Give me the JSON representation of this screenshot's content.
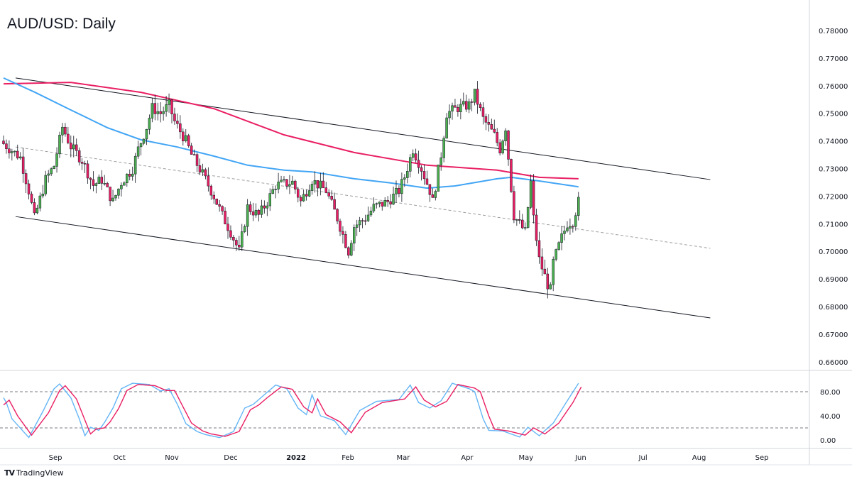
{
  "title": "AUD/USD: Daily",
  "branding": "TradingView",
  "colors": {
    "up": "#4caf50",
    "down": "#e91e63",
    "ma_fast": "#42a5f5",
    "ma_slow": "#e91e63",
    "stoch_k": "#64b5f6",
    "stoch_d": "#e91e63",
    "trend": "#131722",
    "mid": "#9e9e9e"
  },
  "chart_data": {
    "type": "candlestick",
    "title": "AUD/USD: Daily",
    "x_unit": "trading-day index",
    "price_axis": {
      "ticks": [
        "0.78000",
        "0.77000",
        "0.76000",
        "0.75000",
        "0.74000",
        "0.73000",
        "0.72000",
        "0.71000",
        "0.70000",
        "0.69000",
        "0.68000",
        "0.67000",
        "0.66000"
      ],
      "range": [
        0.658,
        0.788
      ]
    },
    "time_axis": {
      "labels": [
        {
          "label": "Sep",
          "bar": 18.5
        },
        {
          "label": "Oct",
          "bar": 41.3
        },
        {
          "label": "Nov",
          "bar": 60
        },
        {
          "label": "Dec",
          "bar": 81
        },
        {
          "label": "2022",
          "bar": 104.3,
          "bold": true
        },
        {
          "label": "Feb",
          "bar": 122.8
        },
        {
          "label": "Mar",
          "bar": 142.5
        },
        {
          "label": "Apr",
          "bar": 165.3
        },
        {
          "label": "May",
          "bar": 186.3
        },
        {
          "label": "Jun",
          "bar": 205.8
        },
        {
          "label": "Jul",
          "bar": 228
        },
        {
          "label": "Aug",
          "bar": 248
        },
        {
          "label": "Sep",
          "bar": 270.4
        }
      ],
      "total_bars": 287
    },
    "close_waypoints": [
      [
        0,
        0.739
      ],
      [
        6,
        0.734
      ],
      [
        9,
        0.722
      ],
      [
        11,
        0.712
      ],
      [
        15,
        0.726
      ],
      [
        18,
        0.731
      ],
      [
        21,
        0.745
      ],
      [
        24,
        0.738
      ],
      [
        28,
        0.733
      ],
      [
        32,
        0.724
      ],
      [
        35,
        0.726
      ],
      [
        39,
        0.718
      ],
      [
        42,
        0.725
      ],
      [
        46,
        0.73
      ],
      [
        48,
        0.737
      ],
      [
        51,
        0.745
      ],
      [
        53,
        0.752
      ],
      [
        56,
        0.75
      ],
      [
        59,
        0.753
      ],
      [
        61,
        0.747
      ],
      [
        65,
        0.74
      ],
      [
        67,
        0.735
      ],
      [
        71,
        0.728
      ],
      [
        75,
        0.72
      ],
      [
        78,
        0.713
      ],
      [
        81,
        0.707
      ],
      [
        84,
        0.7
      ],
      [
        87,
        0.716
      ],
      [
        91,
        0.713
      ],
      [
        94,
        0.718
      ],
      [
        97,
        0.724
      ],
      [
        103,
        0.725
      ],
      [
        106,
        0.718
      ],
      [
        110,
        0.726
      ],
      [
        111,
        0.725
      ],
      [
        115,
        0.722
      ],
      [
        119,
        0.712
      ],
      [
        123,
        0.7
      ],
      [
        125,
        0.709
      ],
      [
        129,
        0.712
      ],
      [
        132,
        0.716
      ],
      [
        137,
        0.718
      ],
      [
        141,
        0.722
      ],
      [
        143,
        0.727
      ],
      [
        146,
        0.737
      ],
      [
        149,
        0.73
      ],
      [
        152,
        0.722
      ],
      [
        153,
        0.718
      ],
      [
        156,
        0.735
      ],
      [
        158,
        0.75
      ],
      [
        162,
        0.752
      ],
      [
        166,
        0.753
      ],
      [
        168,
        0.757
      ],
      [
        171,
        0.748
      ],
      [
        175,
        0.742
      ],
      [
        177,
        0.737
      ],
      [
        179,
        0.745
      ],
      [
        181,
        0.723
      ],
      [
        182,
        0.713
      ],
      [
        186,
        0.707
      ],
      [
        188,
        0.725
      ],
      [
        189,
        0.712
      ],
      [
        191,
        0.697
      ],
      [
        194,
        0.688
      ],
      [
        195,
        0.686
      ],
      [
        196,
        0.696
      ],
      [
        199,
        0.705
      ],
      [
        201,
        0.71
      ],
      [
        203,
        0.711
      ],
      [
        205,
        0.718
      ]
    ],
    "sma_100": [
      [
        0,
        0.7628
      ],
      [
        11,
        0.7577
      ],
      [
        24,
        0.7512
      ],
      [
        37,
        0.7448
      ],
      [
        49,
        0.7404
      ],
      [
        62,
        0.7378
      ],
      [
        75,
        0.7345
      ],
      [
        87,
        0.7312
      ],
      [
        100,
        0.7294
      ],
      [
        110,
        0.7288
      ],
      [
        125,
        0.7263
      ],
      [
        138,
        0.7248
      ],
      [
        151,
        0.7229
      ],
      [
        161,
        0.7237
      ],
      [
        176,
        0.7263
      ],
      [
        181,
        0.7268
      ],
      [
        191,
        0.7255
      ],
      [
        205,
        0.7234
      ]
    ],
    "sma_200": [
      [
        0,
        0.7607
      ],
      [
        24,
        0.7612
      ],
      [
        49,
        0.7576
      ],
      [
        75,
        0.7517
      ],
      [
        100,
        0.7422
      ],
      [
        125,
        0.7358
      ],
      [
        151,
        0.7312
      ],
      [
        176,
        0.7294
      ],
      [
        191,
        0.7268
      ],
      [
        205,
        0.7263
      ]
    ],
    "channel": {
      "upper": [
        [
          4.3,
          0.7628
        ],
        [
          252,
          0.726
        ]
      ],
      "lower": [
        [
          4.3,
          0.7126
        ],
        [
          252,
          0.6759
        ]
      ],
      "mid": [
        [
          4.3,
          0.7378
        ],
        [
          252,
          0.7011
        ]
      ]
    },
    "stochastic": {
      "ticks": [
        "80.00",
        "40.00",
        "0.00"
      ],
      "levels": [
        80,
        20
      ],
      "range": [
        0,
        100
      ],
      "k": [
        [
          0,
          70
        ],
        [
          1,
          62
        ],
        [
          3,
          35
        ],
        [
          9,
          4
        ],
        [
          14,
          47
        ],
        [
          18,
          85
        ],
        [
          20,
          93
        ],
        [
          24,
          70
        ],
        [
          27,
          35
        ],
        [
          29,
          7
        ],
        [
          31,
          21
        ],
        [
          34,
          16
        ],
        [
          36,
          29
        ],
        [
          39,
          53
        ],
        [
          42,
          85
        ],
        [
          46,
          94
        ],
        [
          52,
          92
        ],
        [
          56,
          81
        ],
        [
          59,
          85
        ],
        [
          62,
          59
        ],
        [
          65,
          27
        ],
        [
          69,
          14
        ],
        [
          72,
          9
        ],
        [
          77,
          4
        ],
        [
          82,
          14
        ],
        [
          86,
          53
        ],
        [
          89,
          59
        ],
        [
          92,
          71
        ],
        [
          97,
          91
        ],
        [
          101,
          85
        ],
        [
          105,
          53
        ],
        [
          108,
          42
        ],
        [
          110,
          75
        ],
        [
          113,
          40
        ],
        [
          118,
          32
        ],
        [
          122,
          9
        ],
        [
          127,
          49
        ],
        [
          133,
          64
        ],
        [
          141,
          67
        ],
        [
          145,
          91
        ],
        [
          148,
          62
        ],
        [
          152,
          53
        ],
        [
          156,
          65
        ],
        [
          160,
          94
        ],
        [
          166,
          85
        ],
        [
          168,
          80
        ],
        [
          171,
          35
        ],
        [
          173,
          16
        ],
        [
          178,
          15
        ],
        [
          184,
          5
        ],
        [
          187,
          21
        ],
        [
          191,
          7
        ],
        [
          196,
          28
        ],
        [
          201,
          65
        ],
        [
          205,
          94
        ]
      ],
      "d": [
        [
          0,
          58
        ],
        [
          2,
          66
        ],
        [
          5,
          40
        ],
        [
          10,
          8
        ],
        [
          16,
          45
        ],
        [
          20,
          82
        ],
        [
          22,
          90
        ],
        [
          26,
          68
        ],
        [
          29,
          33
        ],
        [
          31,
          10
        ],
        [
          33,
          18
        ],
        [
          36,
          20
        ],
        [
          38,
          30
        ],
        [
          41,
          52
        ],
        [
          44,
          82
        ],
        [
          48,
          92
        ],
        [
          54,
          90
        ],
        [
          58,
          82
        ],
        [
          61,
          82
        ],
        [
          64,
          55
        ],
        [
          67,
          28
        ],
        [
          71,
          15
        ],
        [
          74,
          10
        ],
        [
          79,
          6
        ],
        [
          84,
          14
        ],
        [
          88,
          50
        ],
        [
          91,
          58
        ],
        [
          94,
          70
        ],
        [
          99,
          88
        ],
        [
          103,
          84
        ],
        [
          107,
          55
        ],
        [
          110,
          45
        ],
        [
          112,
          68
        ],
        [
          115,
          42
        ],
        [
          120,
          30
        ],
        [
          124,
          12
        ],
        [
          129,
          46
        ],
        [
          135,
          62
        ],
        [
          143,
          68
        ],
        [
          147,
          88
        ],
        [
          150,
          66
        ],
        [
          154,
          55
        ],
        [
          158,
          64
        ],
        [
          162,
          92
        ],
        [
          168,
          86
        ],
        [
          170,
          80
        ],
        [
          173,
          40
        ],
        [
          175,
          18
        ],
        [
          180,
          15
        ],
        [
          186,
          8
        ],
        [
          189,
          20
        ],
        [
          193,
          10
        ],
        [
          198,
          28
        ],
        [
          203,
          62
        ],
        [
          206,
          88
        ]
      ]
    }
  }
}
